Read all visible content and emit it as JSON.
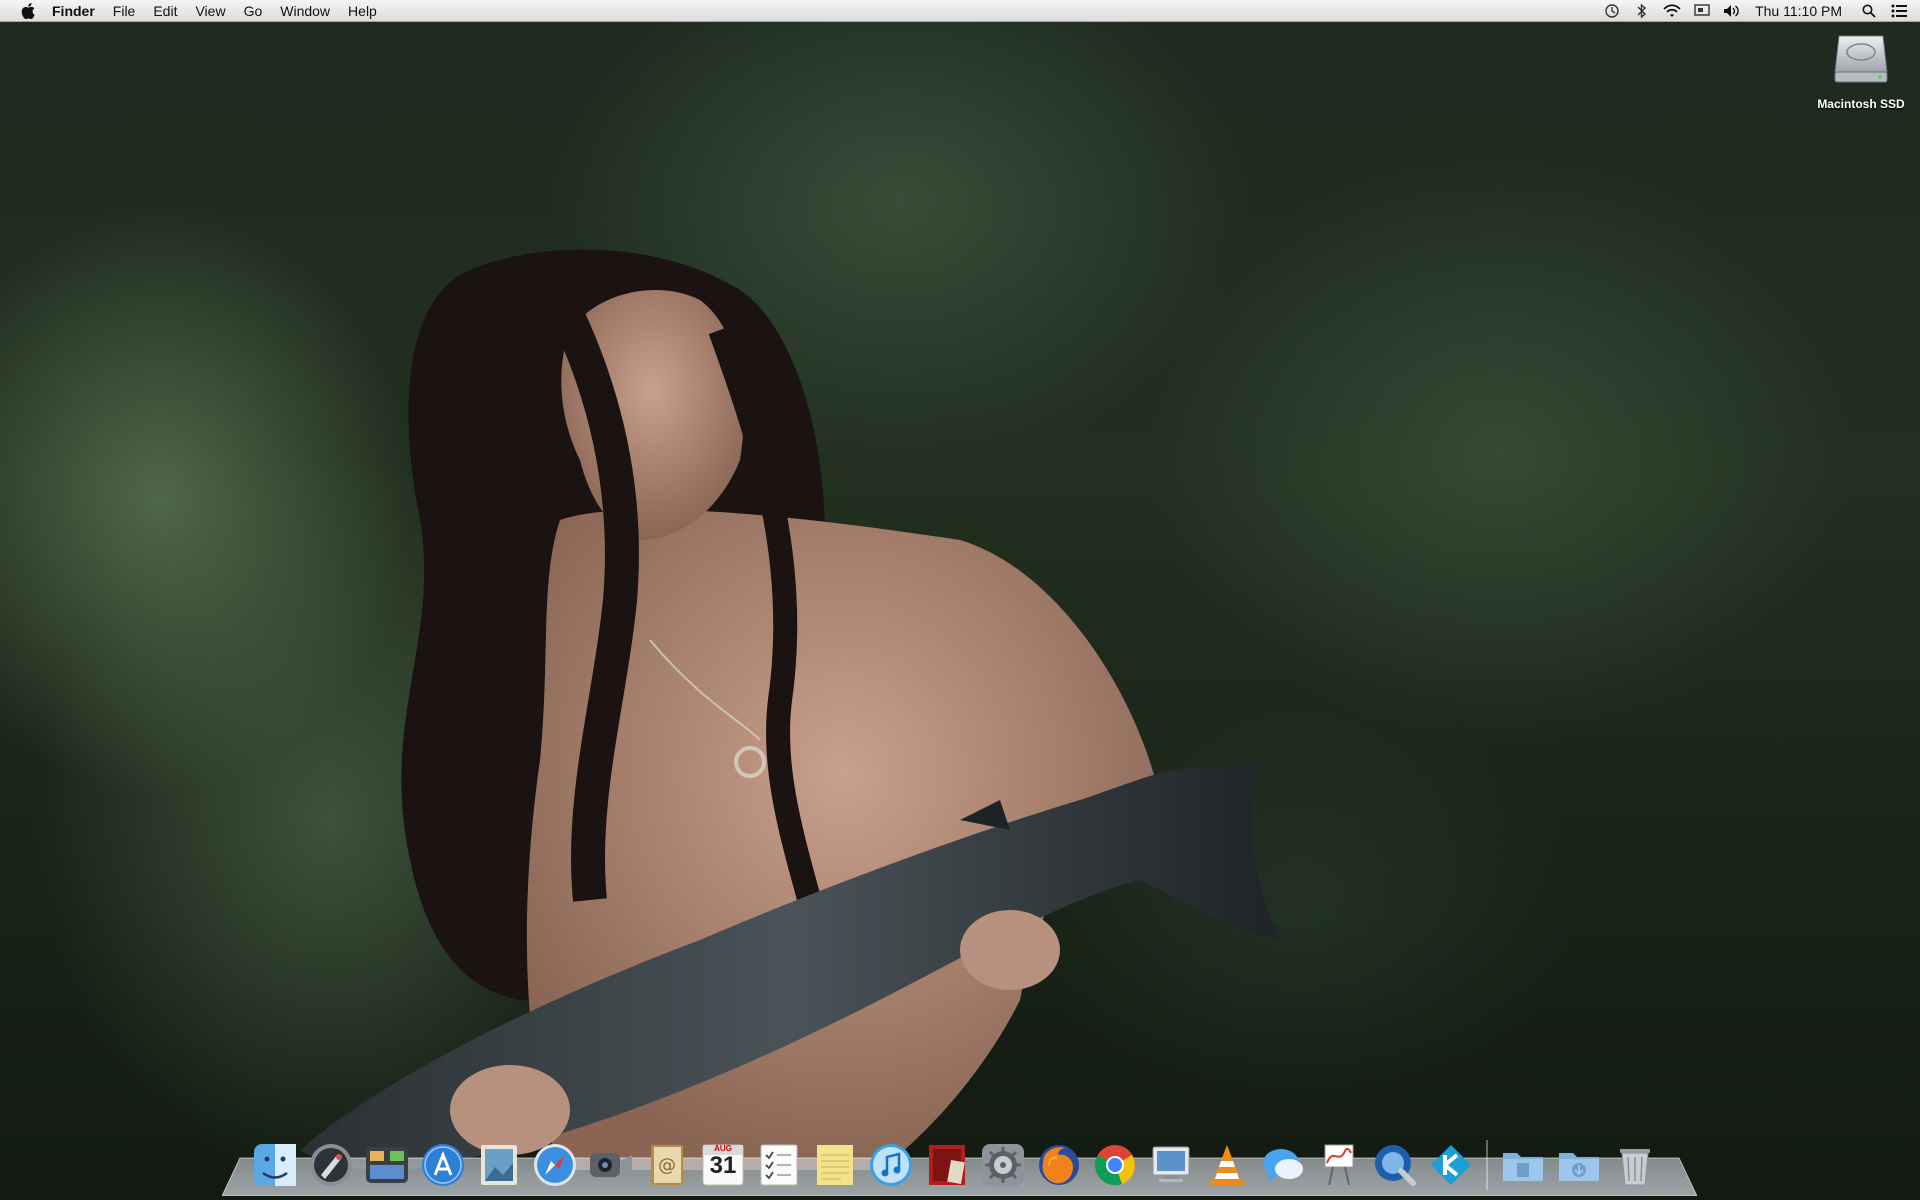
{
  "menubar": {
    "app_name": "Finder",
    "menus": [
      "File",
      "Edit",
      "View",
      "Go",
      "Window",
      "Help"
    ],
    "clock": "Thu 11:10 PM",
    "status_icons": [
      "time-machine-icon",
      "bluetooth-icon",
      "wifi-icon",
      "display-icon",
      "volume-icon",
      "spotlight-icon",
      "notification-center-icon"
    ]
  },
  "desktop": {
    "icons": [
      {
        "label": "Macintosh SSD",
        "icon": "hard-drive-icon"
      }
    ]
  },
  "dock": {
    "calendar": {
      "month": "AUG",
      "day": "31"
    },
    "apps": [
      "finder",
      "launchpad",
      "mission-control",
      "app-store",
      "preview",
      "safari",
      "facetime",
      "contacts",
      "calendar",
      "reminders",
      "notes",
      "itunes",
      "photo-booth",
      "system-preferences",
      "firefox",
      "chrome",
      "remote-desktop",
      "vlc",
      "messages",
      "grapher",
      "quicktime",
      "kodi"
    ],
    "stacks": [
      "documents-folder",
      "downloads-folder",
      "trash"
    ]
  },
  "colors": {
    "menubar_top": "#f4f4f4",
    "menubar_bottom": "#dcdcdc",
    "dock_glass": "#c8ccd0"
  }
}
